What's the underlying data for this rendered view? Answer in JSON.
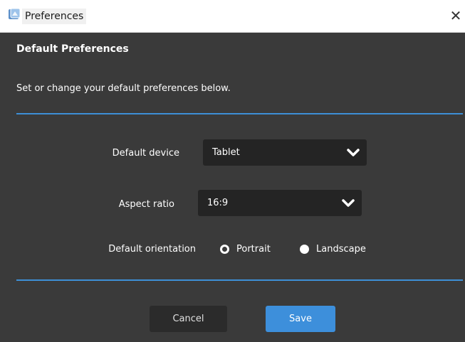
{
  "window": {
    "title": "Preferences",
    "icon": "preferences-app-icon",
    "close_glyph": "✕"
  },
  "header": {
    "title": "Default Preferences",
    "subtitle": "Set or change your default preferences below."
  },
  "form": {
    "device": {
      "label": "Default device",
      "value": "Tablet"
    },
    "aspect_ratio": {
      "label": "Aspect ratio",
      "value": "16:9"
    },
    "orientation": {
      "label": "Default orientation",
      "options": [
        {
          "label": "Portrait",
          "selected": false
        },
        {
          "label": "Landscape",
          "selected": true
        }
      ]
    }
  },
  "buttons": {
    "cancel": "Cancel",
    "save": "Save"
  },
  "colors": {
    "background": "#3a3a3a",
    "accent": "#3d8fdb",
    "select_bg": "#242424"
  }
}
